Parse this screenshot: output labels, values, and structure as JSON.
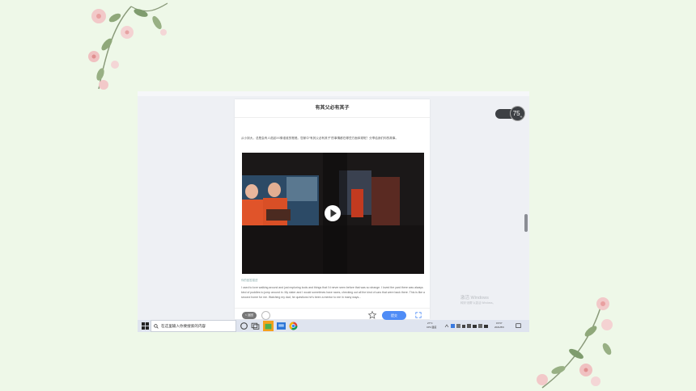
{
  "page": {
    "background": "#eef8e8"
  },
  "decor": {
    "top_left": "flower-branch-decoration",
    "bottom_right": "flower-branch-decoration"
  },
  "screen": {
    "window_title": "有其父必有其子",
    "intro_text": "从小到大，总是会有人说起XX像谁谁的爸爸。您家中“有其父必有其子”的事情都在哪些方面体现呢？分享给我们你的故事。",
    "video": {
      "play_icon": "play-icon"
    },
    "caption": "你的回答描述",
    "paragraph": "I used to love walking around and just exploring tools and things that I'd never seen before that was so strange. I loved the yard there was always kind of puddles to jump around in. My sister and I would sometimes have races, checking out all the kind of cars that were back there. This is like a second home for me. Watching my dad, he questions he's been a mentor to me in many ways...",
    "bottom_bar": {
      "back_label": "< 返回",
      "submit_label": "提交"
    },
    "speed_widget": {
      "value": "75",
      "unit": "%"
    },
    "watermark": {
      "line1": "激活 Windows",
      "line2": "转到“设置”以激活 Windows。"
    },
    "taskbar": {
      "search_placeholder": "在这里输入你要搜索的内容",
      "weather": "27°C",
      "cpu_label": "CPU温度",
      "time": "15:57",
      "date": "2021/8/9"
    }
  },
  "colors": {
    "accent": "#4f8cf6",
    "taskbar": "#dfe4ef",
    "video_orange": "#d9532a"
  }
}
